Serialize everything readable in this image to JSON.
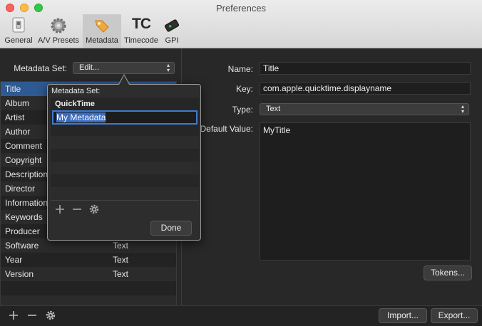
{
  "window": {
    "title": "Preferences"
  },
  "toolbar": {
    "items": [
      {
        "label": "General",
        "icon": "switch-icon"
      },
      {
        "label": "A/V Presets",
        "icon": "gear-icon"
      },
      {
        "label": "Metadata",
        "icon": "tag-icon",
        "selected": true
      },
      {
        "label": "Timecode",
        "icon": "tc-icon",
        "glyph": "TC"
      },
      {
        "label": "GPI",
        "icon": "gpi-device-icon"
      }
    ]
  },
  "metadata_set": {
    "label": "Metadata Set:",
    "value": "Edit..."
  },
  "fields": [
    {
      "name": "Title",
      "value": ""
    },
    {
      "name": "Album",
      "value": ""
    },
    {
      "name": "Artist",
      "value": ""
    },
    {
      "name": "Author",
      "value": ""
    },
    {
      "name": "Comment",
      "value": ""
    },
    {
      "name": "Copyright",
      "value": ""
    },
    {
      "name": "Description",
      "value": ""
    },
    {
      "name": "Director",
      "value": ""
    },
    {
      "name": "Information",
      "value": ""
    },
    {
      "name": "Keywords",
      "value": ""
    },
    {
      "name": "Producer",
      "value": ""
    },
    {
      "name": "Software",
      "value": "Text"
    },
    {
      "name": "Year",
      "value": "Text"
    },
    {
      "name": "Version",
      "value": "Text"
    }
  ],
  "detail": {
    "name_label": "Name:",
    "name_value": "Title",
    "key_label": "Key:",
    "key_value": "com.apple.quicktime.displayname",
    "type_label": "Type:",
    "type_value": "Text",
    "default_label": "Default Value:",
    "default_value": "MyTitle",
    "tokens_button": "Tokens..."
  },
  "popover": {
    "title": "Metadata Set:",
    "group": "QuickTime",
    "editing_value": "My Metadata",
    "done_button": "Done"
  },
  "bottom": {
    "import_button": "Import...",
    "export_button": "Export..."
  }
}
